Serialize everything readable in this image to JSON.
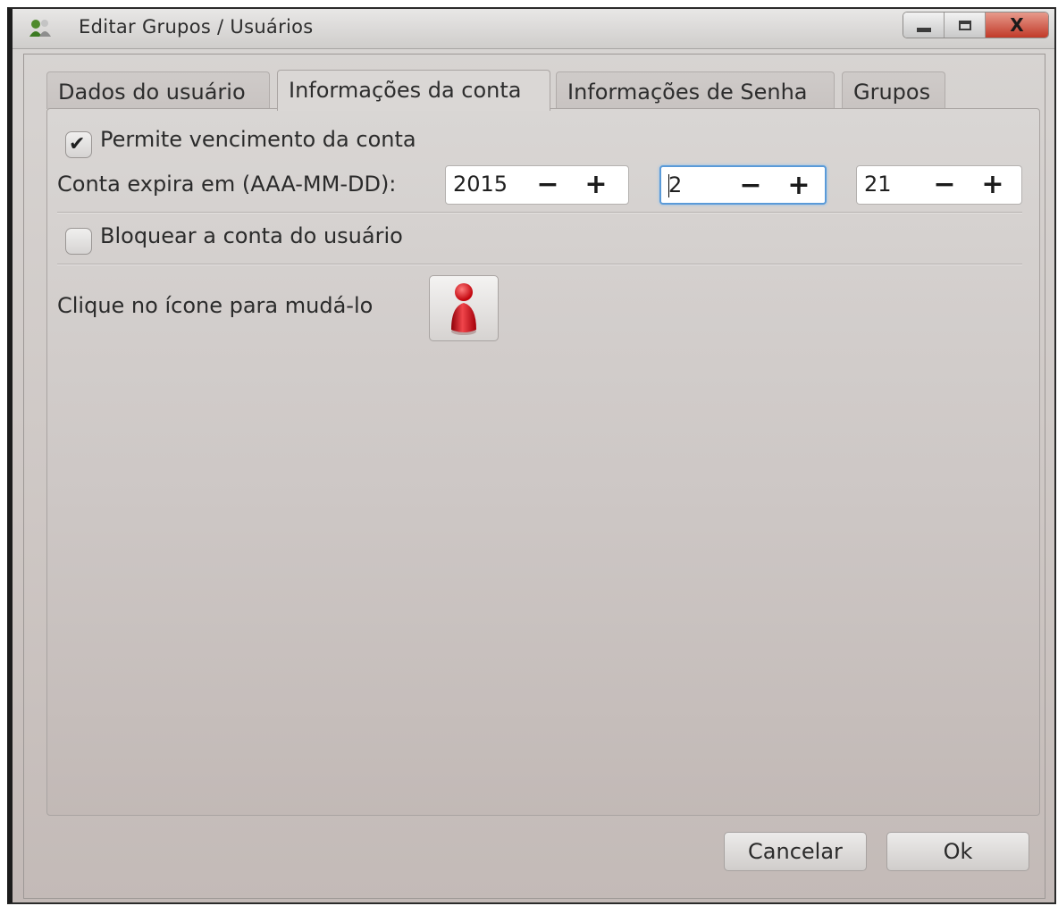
{
  "window": {
    "title": "Editar Grupos / Usuários",
    "controls": {
      "minimize_icon": "minimize-icon",
      "maximize_icon": "maximize-icon",
      "close_label": "X"
    }
  },
  "tabs": [
    {
      "label": "Dados do usuário",
      "active": false
    },
    {
      "label": "Informações da conta",
      "active": true
    },
    {
      "label": "Informações de Senha",
      "active": false
    },
    {
      "label": "Grupos",
      "active": false
    }
  ],
  "account": {
    "allow_expiry": {
      "label": "Permite vencimento da conta",
      "checked": true
    },
    "expires_label": "Conta expira em (AAA-MM-DD):",
    "year": {
      "value": "2015",
      "minus": "−",
      "plus": "+"
    },
    "month": {
      "value": "2",
      "minus": "−",
      "plus": "+"
    },
    "day": {
      "value": "21",
      "minus": "−",
      "plus": "+"
    },
    "lock": {
      "label": "Bloquear a conta do usuário",
      "checked": false
    },
    "icon_hint": "Clique no ícone para mudá-lo",
    "icon_name": "user-avatar-icon"
  },
  "buttons": {
    "cancel": "Cancelar",
    "ok": "Ok"
  },
  "colors": {
    "focus_border": "#5a9ad8",
    "avatar_red": "#d0121a"
  }
}
